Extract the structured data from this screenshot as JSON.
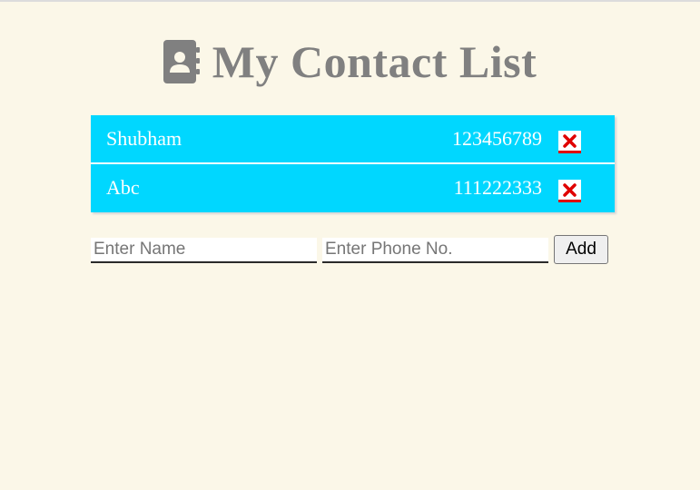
{
  "header": {
    "title": "My Contact List",
    "icon": "address-book-icon",
    "title_color": "#808080"
  },
  "contacts": [
    {
      "name": "Shubham",
      "phone": "123456789",
      "delete_icon": "close-icon"
    },
    {
      "name": "Abc",
      "phone": "111222333",
      "delete_icon": "close-icon"
    }
  ],
  "form": {
    "name_placeholder": "Enter Name",
    "phone_placeholder": "Enter Phone No.",
    "add_label": "Add"
  },
  "colors": {
    "background": "#fbf7e8",
    "row_background": "#00d7ff",
    "delete_accent": "#e00000"
  }
}
